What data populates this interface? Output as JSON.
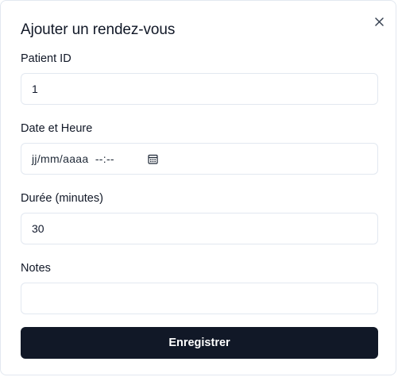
{
  "dialog": {
    "title": "Ajouter un rendez-vous",
    "close_icon": "close-icon"
  },
  "form": {
    "patient_id": {
      "label": "Patient ID",
      "value": "1",
      "placeholder": ""
    },
    "datetime": {
      "label": "Date et Heure",
      "display": "jj/mm/aaaa  --:--",
      "icon": "calendar-icon"
    },
    "duration": {
      "label": "Durée (minutes)",
      "value": "30",
      "placeholder": ""
    },
    "notes": {
      "label": "Notes",
      "value": "",
      "placeholder": ""
    },
    "submit_label": "Enregistrer"
  },
  "colors": {
    "button_bg": "#111827",
    "button_text": "#ffffff",
    "border": "#e2e8f0"
  }
}
